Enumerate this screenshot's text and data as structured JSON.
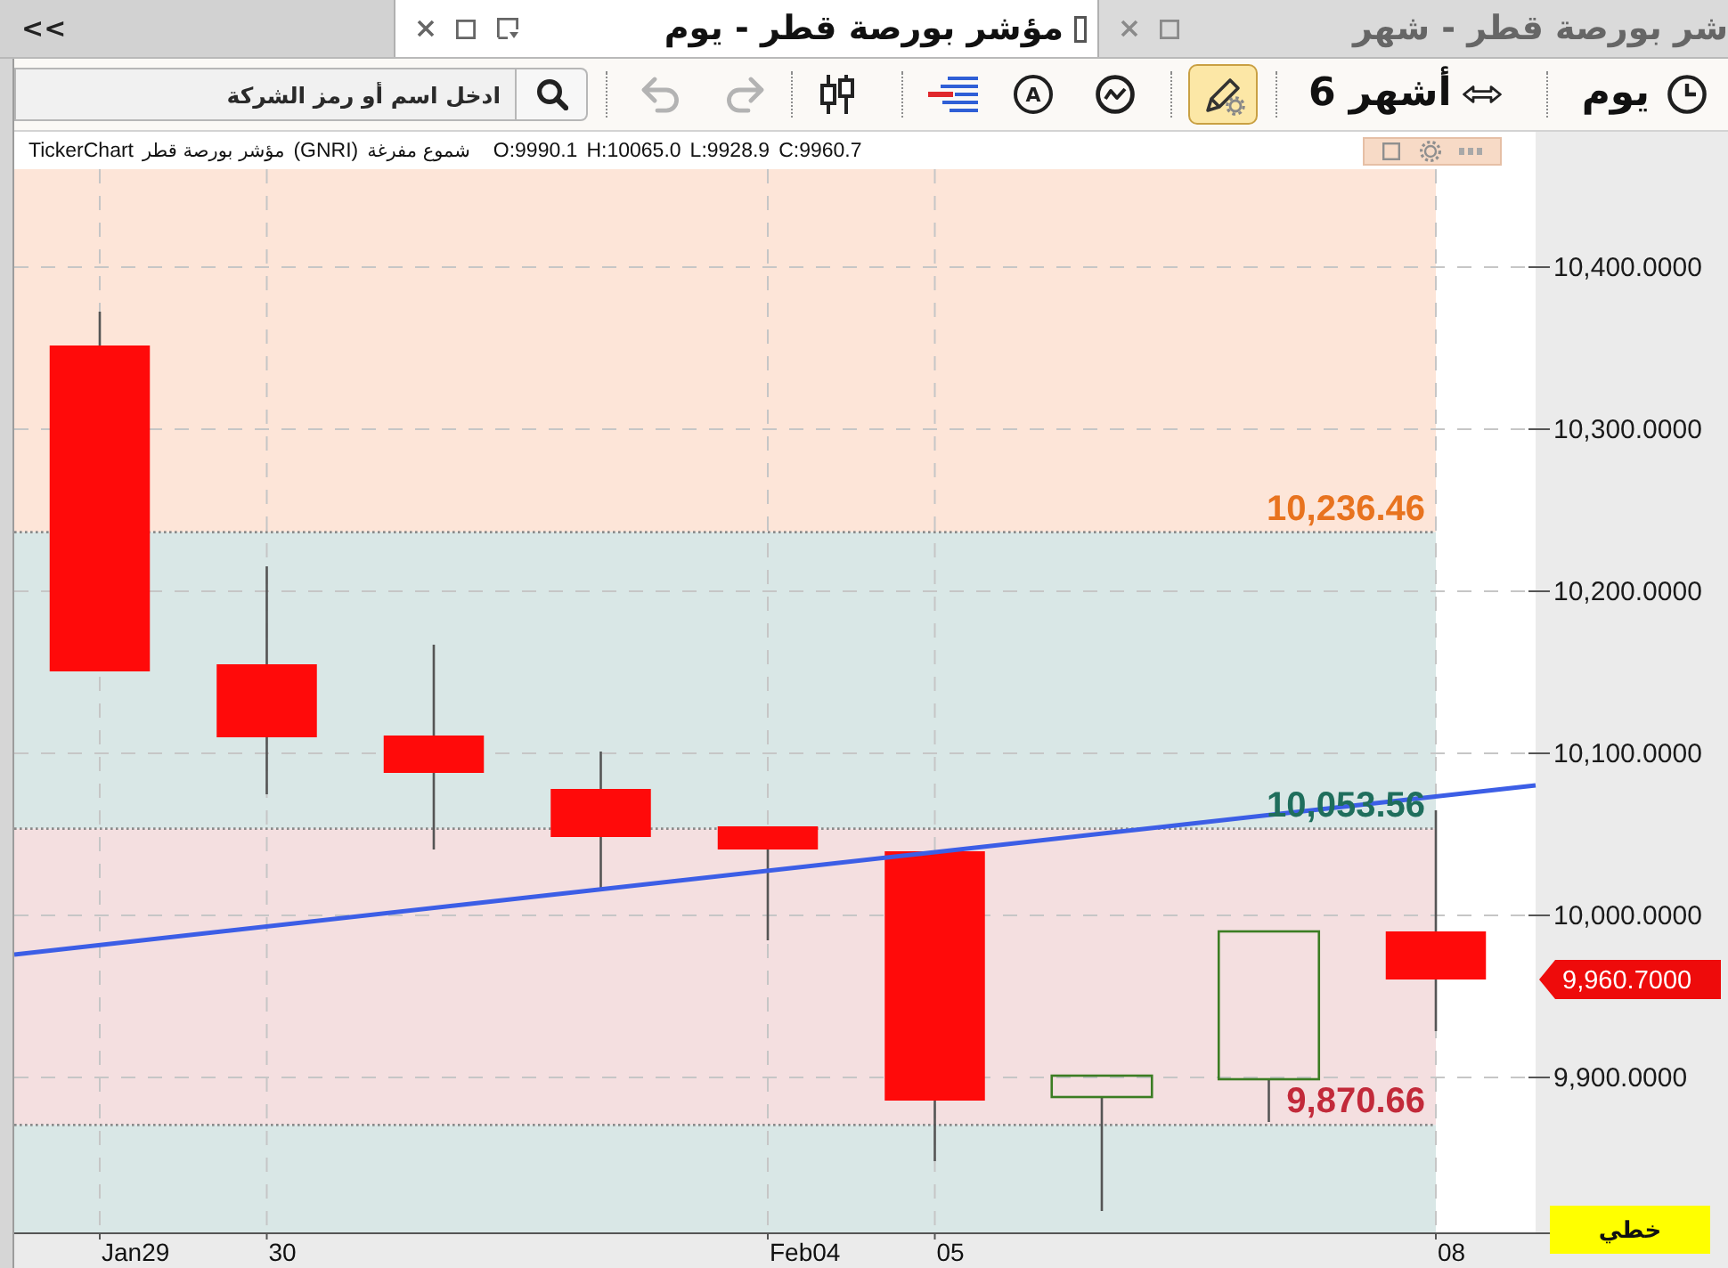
{
  "tab_bar": {
    "overflow_button": "<<",
    "tabs": [
      {
        "title": "شر بورصة قطر - شهر",
        "selected": false
      },
      {
        "title": "مؤشر بورصة قطر - يوم",
        "selected": true
      }
    ]
  },
  "toolbar": {
    "search": {
      "placeholder": "ادخل اسم أو رمز الشركة"
    },
    "undo": {
      "disabled": true
    },
    "redo": {
      "disabled": true
    },
    "letter_tool": "A",
    "drawing_mode": {
      "on": true
    },
    "period": "6 أشهر",
    "interval": "يوم"
  },
  "chart_header": {
    "source": "TickerChart",
    "symbol_name": "مؤشر بورصة قطر",
    "symbol_code": "(GNRI)",
    "chart_style": "شموع مفرغة",
    "ohlc": {
      "open": "O:9990.1",
      "high": "H:10065.0",
      "low": "L:9928.9",
      "close": "C:9960.7"
    }
  },
  "chart": {
    "levels": [
      {
        "label": "10,236.46",
        "color": "#e8731f"
      },
      {
        "label": "10,053.56",
        "color": "#1f6e5c"
      },
      {
        "label": "9,870.66",
        "color": "#c22a3a"
      }
    ],
    "price_axis_labels": [
      "10,400.0000",
      "10,300.0000",
      "10,200.0000",
      "10,100.0000",
      "10,000.0000",
      "9,900.0000"
    ],
    "price_tag": "9,960.7000",
    "date_axis_labels": [
      "08",
      "05",
      "Feb04",
      "30",
      "Jan29"
    ],
    "scale_button": "خطي"
  }
}
